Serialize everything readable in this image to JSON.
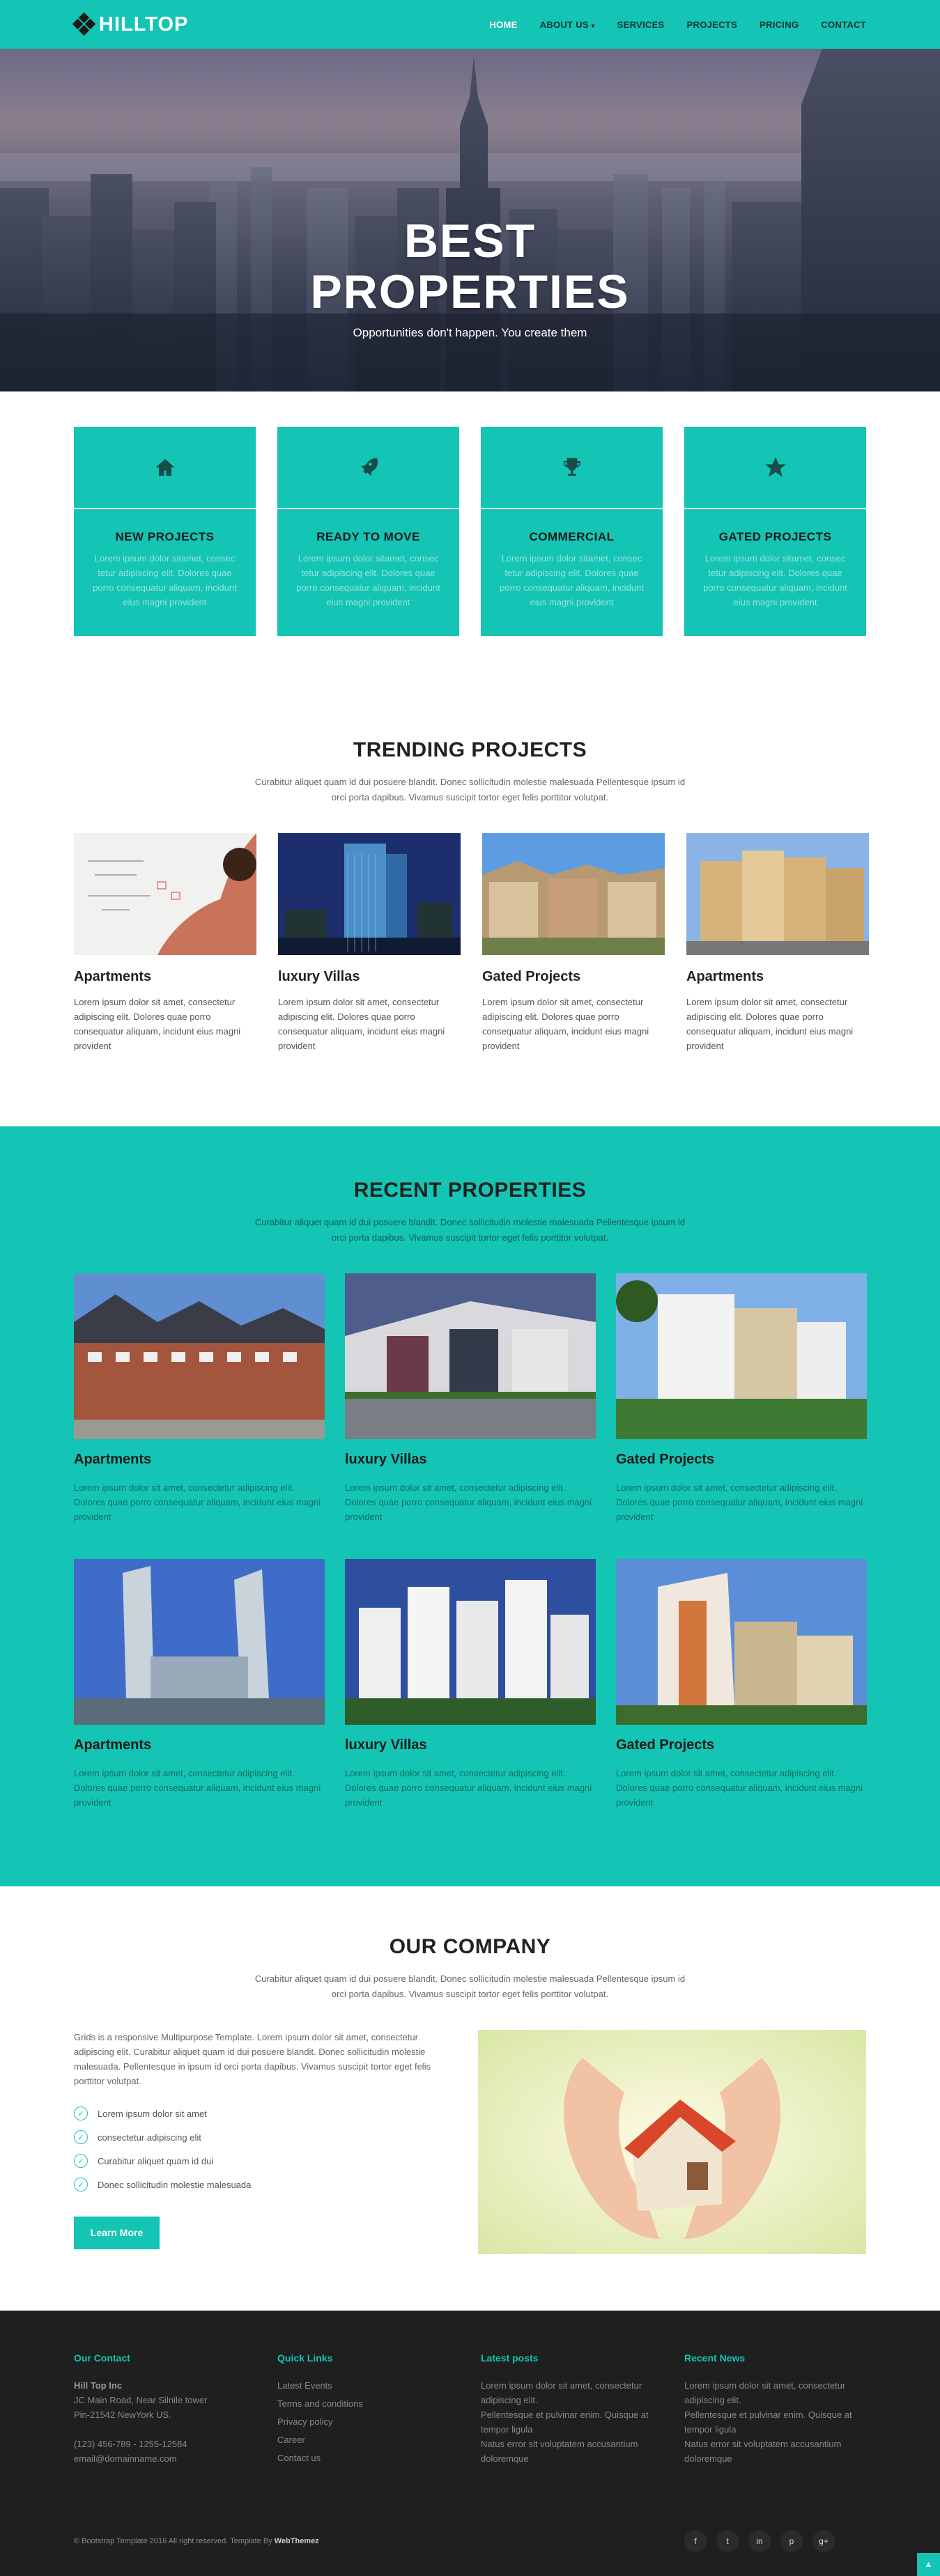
{
  "nav": {
    "brand": "HILLTOP",
    "items": [
      {
        "label": "HOME",
        "active": true
      },
      {
        "label": "ABOUT US",
        "dropdown": true
      },
      {
        "label": "SERVICES"
      },
      {
        "label": "PROJECTS"
      },
      {
        "label": "PRICING"
      },
      {
        "label": "CONTACT"
      }
    ]
  },
  "hero": {
    "title_line1": "BEST",
    "title_line2": "PROPERTIES",
    "subtitle": "Opportunities don't happen. You create them"
  },
  "features": [
    {
      "icon": "home-icon",
      "title": "NEW PROJECTS",
      "text": "Lorem ipsum dolor sitamet, consec tetur adipiscing elit. Dolores quae porro consequatur aliquam, incidunt eius magni provident"
    },
    {
      "icon": "rocket-icon",
      "title": "READY TO MOVE",
      "text": "Lorem ipsum dolor sitamet, consec tetur adipiscing elit. Dolores quae porro consequatur aliquam, incidunt eius magni provident"
    },
    {
      "icon": "trophy-icon",
      "title": "COMMERCIAL",
      "text": "Lorem ipsum dolor sitamet, consec tetur adipiscing elit. Dolores quae porro consequatur aliquam, incidunt eius magni provident"
    },
    {
      "icon": "star-icon",
      "title": "GATED PROJECTS",
      "text": "Lorem ipsum dolor sitamet, consec tetur adipiscing elit. Dolores quae porro consequatur aliquam, incidunt eius magni provident"
    }
  ],
  "trending": {
    "title": "TRENDING PROJECTS",
    "subtitle": "Curabitur aliquet quam id dui posuere blandit. Donec sollicitudin molestie malesuada Pellentesque ipsum id orci porta dapibus. Vivamus suscipit tortor eget felis porttitor volutpat.",
    "items": [
      {
        "title": "Apartments",
        "text": "Lorem ipsum dolor sit amet, consectetur adipiscing elit. Dolores quae porro consequatur aliquam, incidunt eius magni provident"
      },
      {
        "title": "luxury Villas",
        "text": "Lorem ipsum dolor sit amet, consectetur adipiscing elit. Dolores quae porro consequatur aliquam, incidunt eius magni provident"
      },
      {
        "title": "Gated Projects",
        "text": "Lorem ipsum dolor sit amet, consectetur adipiscing elit. Dolores quae porro consequatur aliquam, incidunt eius magni provident"
      },
      {
        "title": "Apartments",
        "text": "Lorem ipsum dolor sit amet, consectetur adipiscing elit. Dolores quae porro consequatur aliquam, incidunt eius magni provident"
      }
    ]
  },
  "recent": {
    "title": "RECENT PROPERTIES",
    "subtitle": "Curabitur aliquet quam id dui posuere blandit. Donec sollicitudin molestie malesuada Pellentesque ipsum id orci porta dapibus. Vivamus suscipit tortor eget felis porttitor volutpat.",
    "items": [
      {
        "title": "Apartments",
        "text": "Lorem ipsum dolor sit amet, consectetur adipiscing elit. Dolores quae porro consequatur aliquam, incidunt eius magni provident"
      },
      {
        "title": "luxury Villas",
        "text": "Lorem ipsum dolor sit amet, consectetur adipiscing elit. Dolores quae porro consequatur aliquam, incidunt eius magni provident"
      },
      {
        "title": "Gated Projects",
        "text": "Lorem ipsum dolor sit amet, consectetur adipiscing elit. Dolores quae porro consequatur aliquam, incidunt eius magni provident"
      },
      {
        "title": "Apartments",
        "text": "Lorem ipsum dolor sit amet, consectetur adipiscing elit. Dolores quae porro consequatur aliquam, incidunt eius magni provident"
      },
      {
        "title": "luxury Villas",
        "text": "Lorem ipsum dolor sit amet, consectetur adipiscing elit. Dolores quae porro consequatur aliquam, incidunt eius magni provident"
      },
      {
        "title": "Gated Projects",
        "text": "Lorem ipsum dolor sit amet, consectetur adipiscing elit. Dolores quae porro consequatur aliquam, incidunt eius magni provident"
      }
    ]
  },
  "company": {
    "title": "OUR COMPANY",
    "subtitle": "Curabitur aliquet quam id dui posuere blandit. Donec sollicitudin molestie malesuada Pellentesque ipsum id orci porta dapibus. Vivamus suscipit tortor eget felis porttitor volutpat.",
    "body": "Grids is a responsive Multipurpose Template. Lorem ipsum dolor sit amet, consectetur adipiscing elit. Curabitur aliquet quam id dui posuere blandit. Donec sollicitudin molestie malesuada. Pellentesque in ipsum id orci porta dapibus. Vivamus suscipit tortor eget felis porttitor volutpat.",
    "list": [
      "Lorem ipsum dolor sit amet",
      "consectetur adipiscing elit",
      "Curabitur aliquet quam id dui",
      "Donec sollicitudin molestie malesuada"
    ],
    "button": "Learn More"
  },
  "footer": {
    "contact": {
      "heading": "Our Contact",
      "name": "Hill Top Inc",
      "address1": "JC Main Road, Near Silnile tower",
      "address2": "Pin-21542 NewYork US.",
      "phone": "(123) 456-789 - 1255-12584",
      "email": "email@domainname.com"
    },
    "links": {
      "heading": "Quick Links",
      "items": [
        "Latest Events",
        "Terms and conditions",
        "Privacy policy",
        "Career",
        "Contact us"
      ]
    },
    "posts": {
      "heading": "Latest posts",
      "items": [
        "Lorem ipsum dolor sit amet, consectetur adipiscing elit.",
        "Pellentesque et pulvinar enim. Quisque at tempor ligula",
        "Natus error sit voluptatem accusantium doloremque"
      ]
    },
    "news": {
      "heading": "Recent News",
      "items": [
        "Lorem ipsum dolor sit amet, consectetur adipiscing elit.",
        "Pellentesque et pulvinar enim. Quisque at tempor ligula",
        "Natus error sit voluptatem accusantium doloremque"
      ]
    },
    "copyright": "© Bootstrap Template 2016 All right reserved. Template By",
    "author": "WebThemez",
    "social": [
      {
        "icon": "facebook-icon",
        "glyph": "f"
      },
      {
        "icon": "twitter-icon",
        "glyph": "t"
      },
      {
        "icon": "linkedin-icon",
        "glyph": "in"
      },
      {
        "icon": "pinterest-icon",
        "glyph": "p"
      },
      {
        "icon": "google-plus-icon",
        "glyph": "g+"
      }
    ]
  },
  "colors": {
    "accent": "#14c4b4",
    "footer_bg": "#1f1f1f"
  }
}
